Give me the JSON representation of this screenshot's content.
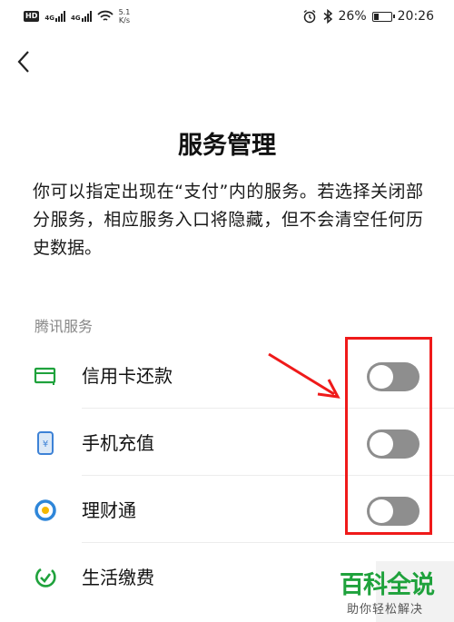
{
  "status_bar": {
    "hd": "HD",
    "net1": "4G",
    "net2": "4G",
    "speed_value": "5.1",
    "speed_unit": "K/s",
    "battery": "26%",
    "time": "20:26"
  },
  "page": {
    "title": "服务管理",
    "description": "你可以指定出现在“支付”内的服务。若选择关闭部分服务，相应服务入口将隐藏，但不会清空任何历史数据。"
  },
  "section": {
    "header": "腾讯服务",
    "items": [
      {
        "label": "信用卡还款",
        "icon": "credit-card-icon",
        "enabled": false
      },
      {
        "label": "手机充值",
        "icon": "phone-topup-icon",
        "enabled": false
      },
      {
        "label": "理财通",
        "icon": "wealth-icon",
        "enabled": false
      },
      {
        "label": "生活缴费",
        "icon": "utility-payment-icon"
      }
    ]
  },
  "colors": {
    "accent_green": "#1fa23c",
    "toggle_off": "#8e8e8e",
    "annotation_red": "#ef1a1a"
  },
  "watermark": {
    "title": "百科全说",
    "subtitle": "助你轻松解决"
  }
}
